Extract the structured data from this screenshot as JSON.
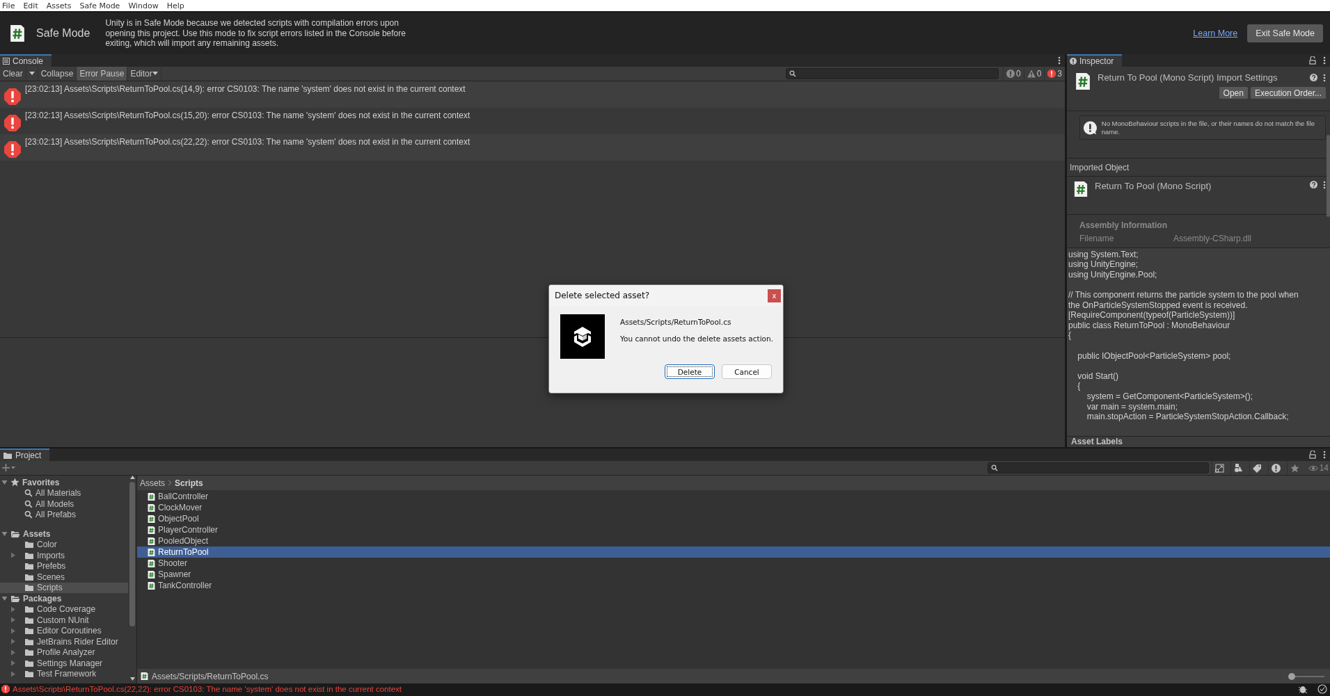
{
  "menu_bar": [
    "File",
    "Edit",
    "Assets",
    "Safe Mode",
    "Window",
    "Help"
  ],
  "safe_mode_banner": {
    "title": "Safe Mode",
    "message": "Unity is in Safe Mode because we detected scripts with compilation errors upon opening this project. Use this mode to fix script errors listed in the Console before exiting, which will import any remaining assets.",
    "link": "Learn More",
    "button": "Exit Safe Mode"
  },
  "console": {
    "tab": "Console",
    "toolbar": {
      "clear": "Clear",
      "collapse": {
        "label": "Collapse",
        "on": false
      },
      "error_pause": {
        "label": "Error Pause",
        "on": true
      },
      "editor": "Editor"
    },
    "counts": [
      {
        "kind": "info",
        "count": "0"
      },
      {
        "kind": "warning",
        "count": "0"
      },
      {
        "kind": "error",
        "count": "3"
      }
    ],
    "messages": [
      {
        "text": "[23:02:13] Assets\\Scripts\\ReturnToPool.cs(14,9): error CS0103: The name 'system' does not exist in the current context"
      },
      {
        "text": "[23:02:13] Assets\\Scripts\\ReturnToPool.cs(15,20): error CS0103: The name 'system' does not exist in the current context"
      },
      {
        "text": "[23:02:13] Assets\\Scripts\\ReturnToPool.cs(22,22): error CS0103: The name 'system' does not exist in the current context"
      }
    ]
  },
  "inspector": {
    "tab": "Inspector",
    "title": "Return To Pool (Mono Script) Import Settings",
    "buttons": [
      "Open",
      "Execution Order..."
    ],
    "warning": "No MonoBehaviour scripts in the file, or their names do not match the file name.",
    "imported_object": "Imported Object",
    "object_title": "Return To Pool (Mono Script)",
    "assembly_heading": "Assembly Information",
    "filename_label": "Filename",
    "filename_value": "Assembly-CSharp.dll",
    "code": "using System.Text;\nusing UnityEngine;\nusing UnityEngine.Pool;\n\n// This component returns the particle system to the pool when\nthe OnParticleSystemStopped event is received.\n[RequireComponent(typeof(ParticleSystem))]\npublic class ReturnToPool : MonoBehaviour\n{\n\n    public IObjectPool<ParticleSystem> pool;\n\n    void Start()\n    {\n        system = GetComponent<ParticleSystem>();\n        var main = system.main;\n        main.stopAction = ParticleSystemStopAction.Callback;",
    "asset_labels": "Asset Labels"
  },
  "project": {
    "tab": "Project",
    "hidden_count": "14",
    "tree": [
      {
        "label": "Favorites",
        "kind": "favorites",
        "expanded": true,
        "selected": false,
        "children": [
          {
            "label": "All Materials",
            "kind": "search",
            "selected": false
          },
          {
            "label": "All Models",
            "kind": "search",
            "selected": false
          },
          {
            "label": "All Prefabs",
            "kind": "search",
            "selected": false
          }
        ]
      },
      {
        "label": "Assets",
        "kind": "folder",
        "expanded": true,
        "selected": false,
        "children": [
          {
            "label": "Color",
            "kind": "folder",
            "selected": false
          },
          {
            "label": "Imports",
            "kind": "folder",
            "expanded": false,
            "selected": false
          },
          {
            "label": "Prefebs",
            "kind": "folder",
            "selected": false
          },
          {
            "label": "Scenes",
            "kind": "folder",
            "selected": false
          },
          {
            "label": "Scripts",
            "kind": "folder",
            "selected": true
          }
        ]
      },
      {
        "label": "Packages",
        "kind": "folder",
        "expanded": true,
        "selected": false,
        "children": [
          {
            "label": "Code Coverage",
            "kind": "folder",
            "expanded": false,
            "selected": false
          },
          {
            "label": "Custom NUnit",
            "kind": "folder",
            "expanded": false,
            "selected": false
          },
          {
            "label": "Editor Coroutines",
            "kind": "folder",
            "expanded": false,
            "selected": false
          },
          {
            "label": "JetBrains Rider Editor",
            "kind": "folder",
            "expanded": false,
            "selected": false
          },
          {
            "label": "Profile Analyzer",
            "kind": "folder",
            "expanded": false,
            "selected": false
          },
          {
            "label": "Settings Manager",
            "kind": "folder",
            "expanded": false,
            "selected": false
          },
          {
            "label": "Test Framework",
            "kind": "folder",
            "expanded": false,
            "selected": false
          }
        ]
      }
    ],
    "breadcrumb": [
      "Assets",
      "Scripts"
    ],
    "files": [
      {
        "name": "BallController",
        "selected": false
      },
      {
        "name": "ClockMover",
        "selected": false
      },
      {
        "name": "ObjectPool",
        "selected": false
      },
      {
        "name": "PlayerController",
        "selected": false
      },
      {
        "name": "PooledObject",
        "selected": false
      },
      {
        "name": "ReturnToPool",
        "selected": true
      },
      {
        "name": "Shooter",
        "selected": false
      },
      {
        "name": "Spawner",
        "selected": false
      },
      {
        "name": "TankController",
        "selected": false
      }
    ],
    "path": "Assets/Scripts/ReturnToPool.cs",
    "zoom": {
      "level": 0
    }
  },
  "status_bar": {
    "message": "Assets\\Scripts\\ReturnToPool.cs(22,22): error CS0103: The name 'system' does not exist in the current context"
  },
  "dialog": {
    "title": "Delete selected asset?",
    "close": "x",
    "path": "Assets/Scripts/ReturnToPool.cs",
    "message": "You cannot undo the delete assets action.",
    "buttons": [
      {
        "label": "Delete",
        "focused": true
      },
      {
        "label": "Cancel",
        "focused": false
      }
    ]
  }
}
